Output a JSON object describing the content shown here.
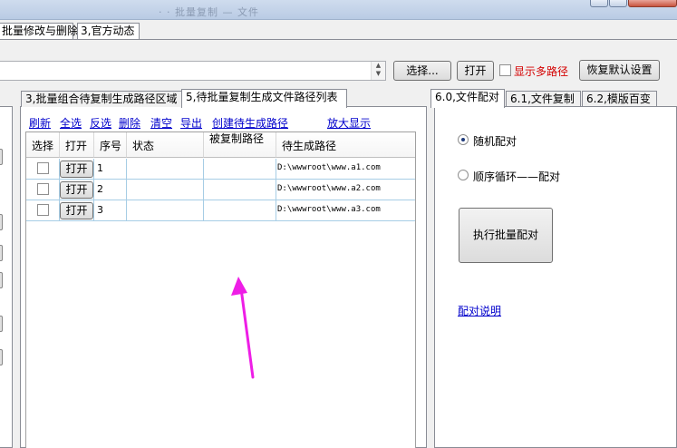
{
  "window": {
    "title_blurred": "· ·  批量复制 — 文件"
  },
  "top_tabs": [
    "批量修改与删除",
    "3,官方动态"
  ],
  "path_row": {
    "path_value": "",
    "select_label": "选择...",
    "open_label": "打开",
    "multi_label": "显示多路径",
    "restore_label": "恢复默认设置"
  },
  "middle": {
    "tabs": [
      "3,批量组合待复制生成路径区域",
      "5,待批量复制生成文件路径列表"
    ],
    "toolbar": [
      "刷新",
      "全选",
      "反选",
      "删除",
      "清空",
      "导出",
      "创建待生成路径",
      "放大显示"
    ],
    "columns": [
      "选择",
      "打开",
      "序号",
      "状态",
      "被复制路径",
      "待生成路径"
    ],
    "rows": [
      {
        "open": "打开",
        "index": "1",
        "status": "",
        "source": "",
        "target": "D:\\wwwroot\\www.a1.com"
      },
      {
        "open": "打开",
        "index": "2",
        "status": "",
        "source": "",
        "target": "D:\\wwwroot\\www.a2.com"
      },
      {
        "open": "打开",
        "index": "3",
        "status": "",
        "source": "",
        "target": "D:\\wwwroot\\www.a3.com"
      }
    ]
  },
  "right": {
    "tabs": [
      "6.0,文件配对",
      "6.1,文件复制",
      "6.2,模版百变"
    ],
    "radio_random": "随机配对",
    "radio_sequence": "顺序循环——配对",
    "selected_radio": "random",
    "exec_label": "执行批量配对",
    "help_link": "配对说明"
  },
  "colors": {
    "accent_red": "#d40000",
    "link_blue": "#0000cc",
    "arrow_magenta": "#ee1ee6",
    "grid_line": "#a7cde5"
  }
}
